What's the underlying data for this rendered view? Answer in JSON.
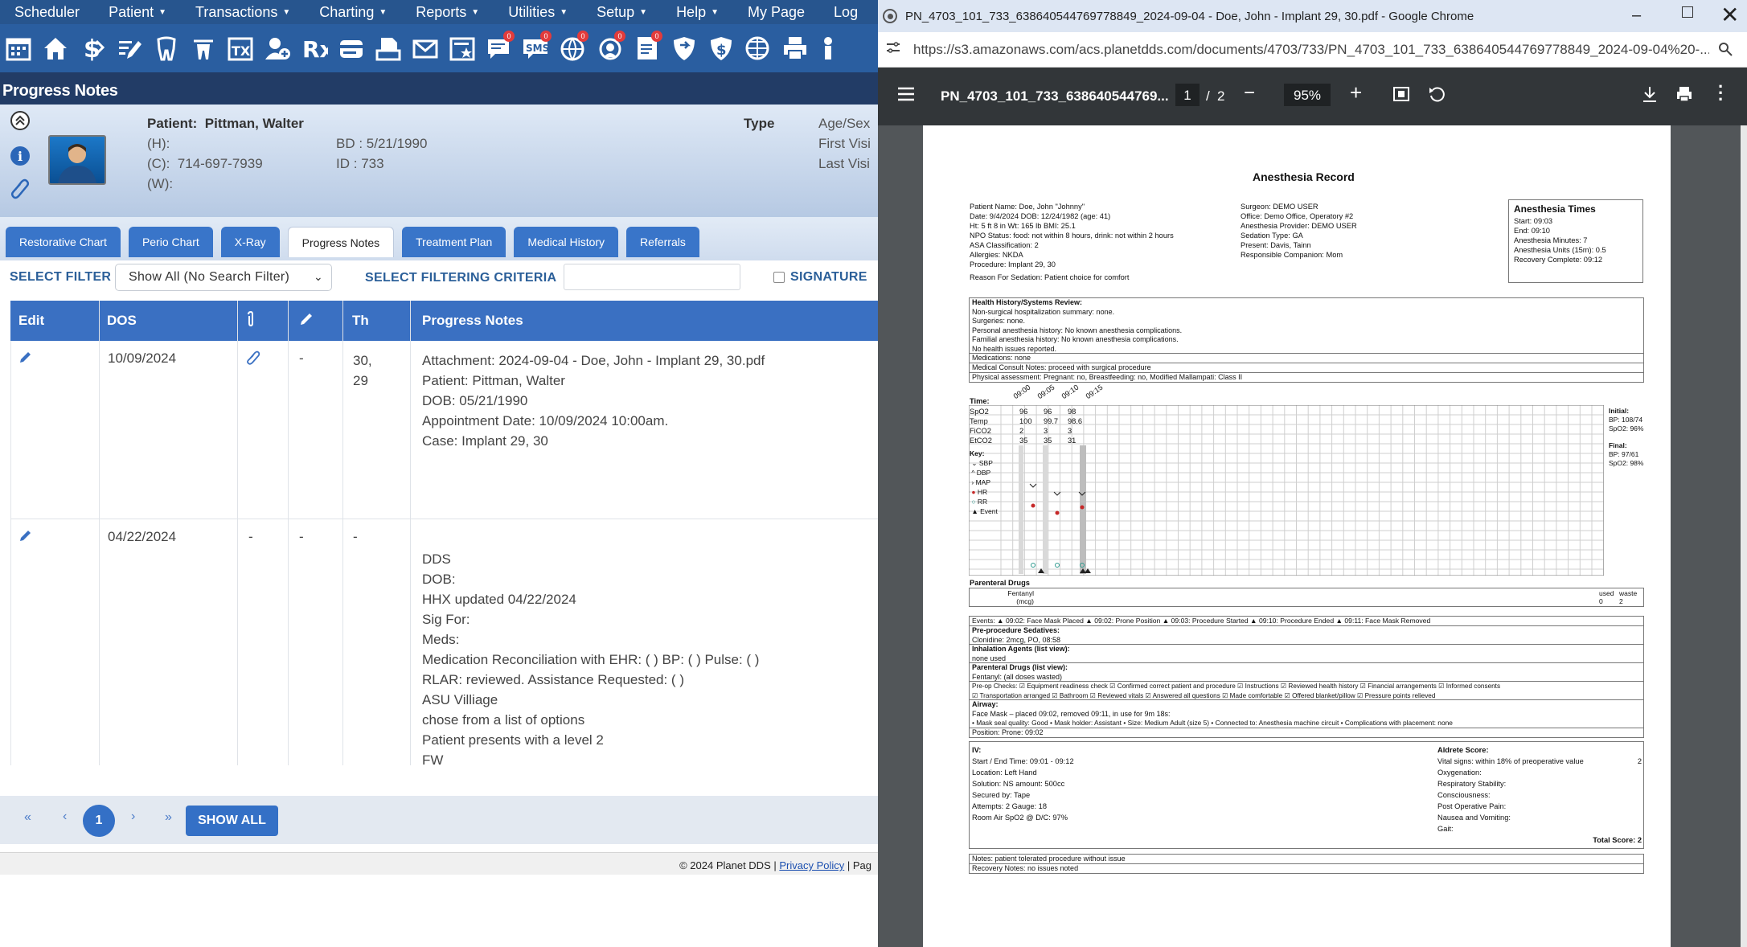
{
  "menu": {
    "items": [
      "Scheduler",
      "Patient",
      "Transactions",
      "Charting",
      "Reports",
      "Utilities",
      "Setup",
      "Help",
      "My Page",
      "Log"
    ]
  },
  "toolbar": {
    "icons": [
      "calendar-icon",
      "home-icon",
      "money-icon",
      "edit-icon",
      "tooth-icon",
      "tooth-x-icon",
      "tx-icon",
      "add-user-icon",
      "rx-icon",
      "card-icon",
      "scanner-icon",
      "mail-icon",
      "star-list-icon",
      "chat-icon",
      "sms-icon",
      "globe-icon",
      "support-icon",
      "forms-icon",
      "shield-icon",
      "dollar-shield-icon",
      "globe-net-icon",
      "print-icon",
      "person-icon"
    ]
  },
  "header": {
    "title": "Progress Notes"
  },
  "patient": {
    "name_label": "Patient:",
    "name": "Pittman, Walter",
    "home_label": "(H):",
    "cell_label": "(C):",
    "cell": "714-697-7939",
    "work_label": "(W):",
    "bd_label": "BD :",
    "bd": "5/21/1990",
    "id_label": "ID :",
    "id": "733",
    "type_label": "Type",
    "age_label": "Age/Sex",
    "first_visit_label": "First Visi",
    "last_visit_label": "Last Visi"
  },
  "tabs": [
    "Restorative Chart",
    "Perio Chart",
    "X-Ray",
    "Progress Notes",
    "Treatment Plan",
    "Medical History",
    "Referrals"
  ],
  "filter": {
    "select_label": "SELECT FILTER",
    "select_value": "Show All (No Search Filter)",
    "criteria_label": "SELECT FILTERING CRITERIA",
    "signature_label": "SIGNATURE"
  },
  "table": {
    "headers": {
      "edit": "Edit",
      "dos": "DOS",
      "th": "Th",
      "notes": "Progress Notes"
    },
    "rows": [
      {
        "dos": "10/09/2024",
        "attach": "",
        "sign": "-",
        "th": "30,\n29",
        "notes": [
          "Attachment: 2024-09-04 - Doe, John - Implant 29, 30.pdf",
          "Patient: Pittman, Walter",
          "DOB: 05/21/1990",
          "Appointment Date: 10/09/2024 10:00am.",
          "Case: Implant  29, 30"
        ]
      },
      {
        "dos": "04/22/2024",
        "attach": "-",
        "sign": "-",
        "th": "-",
        "notes": [
          "",
          "DDS",
          "DOB:",
          "HHX updated 04/22/2024",
          "Sig For:",
          "Meds:",
          "Medication Reconciliation with EHR:  ( )   BP: ( ) Pulse: ( )",
          "RLAR: reviewed.  Assistance Requested: ( )",
          "ASU Villiage",
          "chose from a list of options",
          "Patient presents with a level 2",
          "FW"
        ]
      }
    ]
  },
  "pager": {
    "first": "«",
    "prev": "‹",
    "current": "1",
    "next": "›",
    "last": "»",
    "show_all": "SHOW ALL"
  },
  "footer": {
    "copyright": "© 2024 Planet DDS | ",
    "privacy": "Privacy Policy",
    "rest": " | Pag"
  },
  "chrome": {
    "title": "PN_4703_101_733_638640544769778849_2024-09-04 - Doe, John - Implant 29, 30.pdf - Google Chrome",
    "url": "https://s3.amazonaws.com/acs.planetdds.com/documents/4703/733/PN_4703_101_733_638640544769778849_2024-09-04%20-...",
    "pdf_name": "PN_4703_101_733_638640544769...",
    "page_current": "1",
    "page_sep": "/",
    "page_total": "2",
    "zoom": "95%"
  },
  "pdf": {
    "title": "Anesthesia Record",
    "left_info": [
      "Patient Name: Doe, John \"Johnny\"",
      "Date: 9/4/2024  DOB: 12/24/1982 (age: 41)",
      "Ht: 5 ft 8 in   Wt: 165 lb   BMI: 25.1",
      "NPO Status: food: not within 8 hours, drink: not within 2 hours",
      "ASA Classification: 2",
      "Allergies: NKDA",
      "Procedure: Implant 29, 30",
      "Reason For Sedation: Patient choice for comfort"
    ],
    "mid_info": [
      "Surgeon: DEMO USER",
      "Office: Demo Office, Operatory #2",
      "Anesthesia Provider: DEMO USER",
      "Sedation Type: GA",
      "Present: Davis, Tainn",
      "Responsible Companion: Mom"
    ],
    "times_title": "Anesthesia Times",
    "times": [
      "Start: 09:03",
      "End: 09:10",
      "Anesthesia Minutes: 7",
      "Anesthesia Units (15m): 0.5",
      "Recovery Complete: 09:12"
    ],
    "health_history": [
      "Health History/Systems Review:",
      "Non-surgical hospitalization summary: none.",
      "Surgeries: none.",
      "Personal anesthesia history: No known anesthesia complications.",
      "Familial anesthesia history: No known anesthesia complications.",
      "No health issues reported."
    ],
    "medications": "Medications: none",
    "consult": "Medical Consult Notes: proceed with surgical procedure",
    "physical": "Physical assessment: Pregnant: no, Breastfeeding: no, Modified Mallampati: Class II",
    "time_label": "Time:",
    "times_axis": [
      "09:00",
      "09:05",
      "09:10",
      "09:15"
    ],
    "vitals": [
      {
        "name": "SpO2",
        "vals": [
          "96",
          "96",
          "98"
        ]
      },
      {
        "name": "Temp",
        "vals": [
          "100",
          "99.7",
          "98.6"
        ]
      },
      {
        "name": "FiCO2",
        "vals": [
          "2",
          "3",
          "3"
        ]
      },
      {
        "name": "EtCO2",
        "vals": [
          "35",
          "35",
          "31"
        ]
      }
    ],
    "key_title": "Key:",
    "key": [
      "SBP",
      "DBP",
      "MAP",
      "HR",
      "RR",
      "Event"
    ],
    "initial": [
      "Initial:",
      "BP: 108/74",
      "SpO2: 96%"
    ],
    "final": [
      "Final:",
      "BP: 97/61",
      "SpO2: 98%"
    ],
    "parenteral_title": "Parenteral Drugs",
    "fentanyl": "Fentanyl",
    "fentanyl_unit": "(mcg)",
    "used_label": "used",
    "waste_label": "waste",
    "used_val": "0",
    "waste_val": "2",
    "events": "Events: ▲ 09:02: Face Mask Placed  ▲ 09:02: Prone Position  ▲ 09:03: Procedure Started  ▲ 09:10: Procedure Ended  ▲ 09:11: Face Mask Removed",
    "preproc": [
      "Pre-procedure Sedatives:",
      "Clonidine: 2mcg, PO, 08:58"
    ],
    "inhalation": [
      "Inhalation Agents (list view):",
      "none used"
    ],
    "parenteral_list": [
      "Parenteral Drugs (list view):",
      "Fentanyl: (all doses wasted)"
    ],
    "preop": [
      "Pre-op Checks: ☑ Equipment readiness check  ☑ Confirmed correct patient and procedure  ☑ Instructions  ☑ Reviewed health history  ☑ Financial arrangements  ☑ Informed consents",
      "☑ Transportation arranged  ☑ Bathroom  ☑ Reviewed vitals  ☑ Answered all questions  ☑ Made comfortable  ☑ Offered blanket/pillow  ☑ Pressure points relieved"
    ],
    "airway": [
      "Airway:",
      "Face Mask – placed 09:02, removed 09:11, in use for 9m 18s:",
      "  •  Mask seal quality: Good    •  Mask holder: Assistant    •  Size: Medium Adult (size 5)    •  Connected to: Anesthesia machine circuit    •  Complications with placement: none"
    ],
    "position": "Position: Prone: 09:02",
    "iv": [
      "IV:",
      "Start / End Time: 09:01 - 09:12",
      "Location: Left Hand",
      "Solution: NS amount: 500cc",
      "Secured by: Tape",
      "Attempts: 2 Gauge: 18",
      "Room Air SpO2 @ D/C: 97%"
    ],
    "aldrete_title": "Aldrete Score:",
    "aldrete": [
      {
        "k": "Vital signs: within 18% of preoperative value",
        "v": "2"
      },
      {
        "k": "Oxygenation:",
        "v": ""
      },
      {
        "k": "Respiratory Stability:",
        "v": ""
      },
      {
        "k": "Consciousness:",
        "v": ""
      },
      {
        "k": "Post Operative Pain:",
        "v": ""
      },
      {
        "k": "Nausea and Vomiting:",
        "v": ""
      },
      {
        "k": "Gait:",
        "v": ""
      }
    ],
    "total": "Total Score: 2",
    "notes": "Notes: patient tolerated procedure without issue",
    "recovery": "Recovery Notes: no issues noted"
  }
}
